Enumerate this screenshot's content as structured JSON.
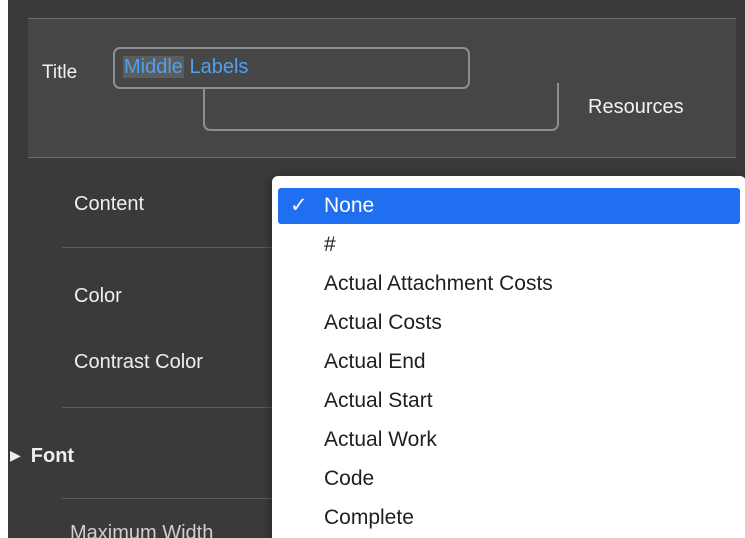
{
  "header": {
    "title_label": "Title",
    "title_value_selected": "Middle",
    "title_value_rest": " Labels",
    "resources_label": "Resources"
  },
  "rows": {
    "content": "Content",
    "color": "Color",
    "contrast_color": "Contrast Color",
    "font": "Font",
    "cut_off": "Maximum Width"
  },
  "dropdown": {
    "check": "✓",
    "options": [
      "None",
      "#",
      "Actual Attachment Costs",
      "Actual Costs",
      "Actual End",
      "Actual Start",
      "Actual Work",
      "Code",
      "Complete"
    ],
    "selected_index": 0
  },
  "colors": {
    "panel_bg": "#3a3a3a",
    "highlight": "#1f6ff0",
    "accent_text": "#4fa0f0"
  }
}
